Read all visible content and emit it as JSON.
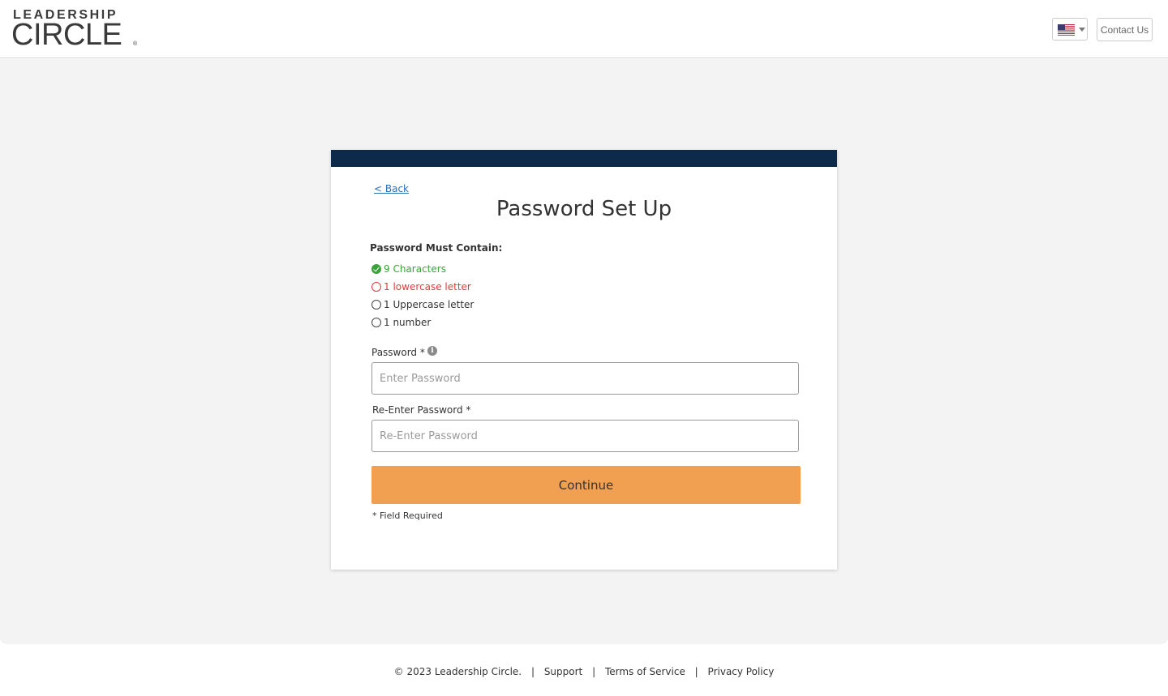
{
  "header": {
    "logo_top": "LEADERSHIP",
    "logo_bottom": "CIRCLE",
    "logo_reg": "®",
    "language_flag_icon": "us-flag-icon",
    "contact_label": "Contact Us"
  },
  "card": {
    "back_label": "< Back",
    "title": "Password Set Up",
    "requirements_heading": "Password Must Contain:",
    "requirements": [
      {
        "label": "9 Characters",
        "status": "met",
        "color": "#3aa23a"
      },
      {
        "label": "1 lowercase letter",
        "status": "error",
        "color": "#e03b3b"
      },
      {
        "label": "1 Uppercase letter",
        "status": "unmet",
        "color": "#333333"
      },
      {
        "label": "1 number",
        "status": "unmet",
        "color": "#333333"
      }
    ],
    "password_label": "Password *",
    "password_placeholder": "Enter Password",
    "password_value": "",
    "reenter_label": "Re-Enter Password *",
    "reenter_placeholder": "Re-Enter Password",
    "reenter_value": "",
    "continue_label": "Continue",
    "field_required_note": "* Field Required"
  },
  "footer": {
    "copyright": "© 2023 Leadership Circle.",
    "separator": "|",
    "links": [
      "Support",
      "Terms of Service",
      "Privacy Policy"
    ]
  },
  "colors": {
    "band": "#0d2a4a",
    "button": "#f0a050",
    "link": "#2a6fb0",
    "background": "#f3f3f3"
  }
}
